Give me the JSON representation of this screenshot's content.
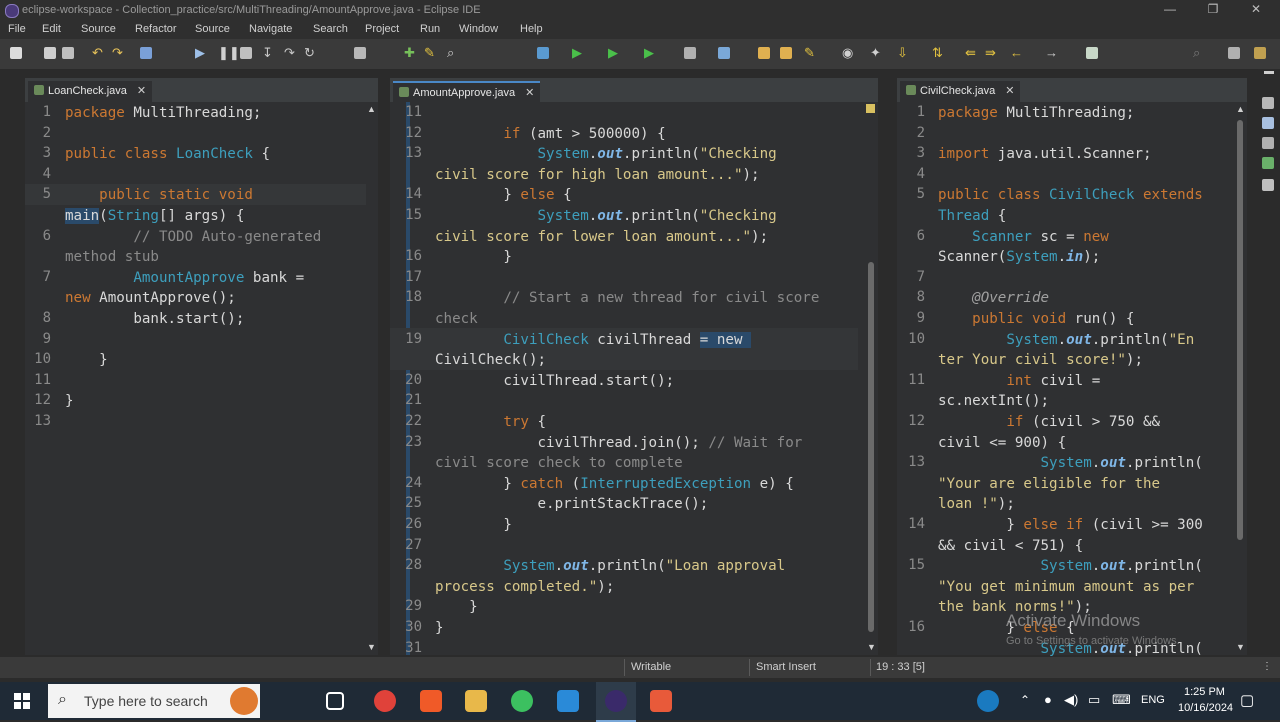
{
  "window": {
    "title": "eclipse-workspace - Collection_practice/src/MultiThreading/AmountApprove.java - Eclipse IDE",
    "controls": {
      "minimize": "—",
      "maximize": "❐",
      "close": "✕"
    }
  },
  "menu": {
    "items": [
      "File",
      "Edit",
      "Source",
      "Refactor",
      "Source",
      "Navigate",
      "Search",
      "Project",
      "Run",
      "Window",
      "Help"
    ]
  },
  "editors": {
    "left": {
      "tab": "LoanCheck.java",
      "lines": [
        {
          "n": "1",
          "segs": [
            [
              "k",
              "package "
            ],
            [
              "",
              "MultiThreading;"
            ]
          ]
        },
        {
          "n": "2",
          "segs": []
        },
        {
          "n": "3",
          "segs": [
            [
              "k",
              "public class "
            ],
            [
              "cls",
              "LoanCheck"
            ],
            [
              "",
              " {"
            ]
          ]
        },
        {
          "n": "4",
          "segs": []
        },
        {
          "n": "5",
          "segs": [
            [
              "k",
              "    public static void"
            ]
          ]
        },
        {
          "n": "",
          "segs": [
            [
              "hl",
              "main"
            ],
            [
              "",
              "("
            ],
            [
              "ty",
              "String"
            ],
            [
              "",
              "[] "
            ],
            [
              "",
              "args) {"
            ]
          ]
        },
        {
          "n": "6",
          "segs": [
            [
              "cm",
              "        // "
            ],
            [
              "cm",
              "TODO"
            ],
            [
              "cm",
              " Auto-generated"
            ]
          ]
        },
        {
          "n": "",
          "segs": [
            [
              "cm",
              "method stub"
            ]
          ]
        },
        {
          "n": "7",
          "segs": [
            [
              "ty",
              "        AmountApprove"
            ],
            [
              "",
              " bank ="
            ]
          ]
        },
        {
          "n": "",
          "segs": [
            [
              "k",
              "new "
            ],
            [
              "",
              "AmountApprove();"
            ]
          ]
        },
        {
          "n": "8",
          "segs": [
            [
              "",
              "        bank.start();"
            ]
          ]
        },
        {
          "n": "9",
          "segs": []
        },
        {
          "n": "10",
          "segs": [
            [
              "",
              "    }"
            ]
          ]
        },
        {
          "n": "11",
          "segs": []
        },
        {
          "n": "12",
          "segs": [
            [
              "",
              "}"
            ]
          ]
        },
        {
          "n": "13",
          "segs": []
        }
      ]
    },
    "middle": {
      "tab": "AmountApprove.java",
      "lines": [
        {
          "n": "11",
          "segs": []
        },
        {
          "n": "12",
          "segs": [
            [
              "k",
              "        if "
            ],
            [
              "",
              "(amt > 500000) {"
            ]
          ]
        },
        {
          "n": "13",
          "segs": [
            [
              "sys",
              "            System"
            ],
            [
              "",
              "."
            ],
            [
              "fi",
              "out"
            ],
            [
              "",
              ".println("
            ],
            [
              "st",
              "\"Checking"
            ]
          ]
        },
        {
          "n": "",
          "segs": [
            [
              "st",
              "civil score for high loan amount...\""
            ],
            [
              "",
              ");"
            ]
          ]
        },
        {
          "n": "14",
          "segs": [
            [
              "",
              "        } "
            ],
            [
              "k",
              "else"
            ],
            [
              "",
              " {"
            ]
          ]
        },
        {
          "n": "15",
          "segs": [
            [
              "sys",
              "            System"
            ],
            [
              "",
              "."
            ],
            [
              "fi",
              "out"
            ],
            [
              "",
              ".println("
            ],
            [
              "st",
              "\"Checking"
            ]
          ]
        },
        {
          "n": "",
          "segs": [
            [
              "st",
              "civil score for lower loan amount...\""
            ],
            [
              "",
              ");"
            ]
          ]
        },
        {
          "n": "16",
          "segs": [
            [
              "",
              "        }"
            ]
          ]
        },
        {
          "n": "17",
          "segs": []
        },
        {
          "n": "18",
          "segs": [
            [
              "cm",
              "        // Start a new thread for civil score"
            ]
          ]
        },
        {
          "n": "",
          "segs": [
            [
              "cm",
              "check"
            ]
          ]
        },
        {
          "n": "19",
          "segs": [
            [
              "ty",
              "        CivilCheck"
            ],
            [
              "",
              " civilThread "
            ],
            [
              "hl",
              "= new "
            ]
          ]
        },
        {
          "n": "",
          "segs": [
            [
              "",
              "CivilCheck();"
            ]
          ]
        },
        {
          "n": "20",
          "segs": [
            [
              "",
              "        civilThread.start();"
            ]
          ]
        },
        {
          "n": "21",
          "segs": []
        },
        {
          "n": "22",
          "segs": [
            [
              "k",
              "        try"
            ],
            [
              "",
              " {"
            ]
          ]
        },
        {
          "n": "23",
          "segs": [
            [
              "",
              "            civilThread.join(); "
            ],
            [
              "cm",
              "// Wait for"
            ]
          ]
        },
        {
          "n": "",
          "segs": [
            [
              "cm",
              "civil score check to complete"
            ]
          ]
        },
        {
          "n": "24",
          "segs": [
            [
              "",
              "        } "
            ],
            [
              "k",
              "catch"
            ],
            [
              "",
              " ("
            ],
            [
              "ty",
              "InterruptedException"
            ],
            [
              "",
              " e) {"
            ]
          ]
        },
        {
          "n": "25",
          "segs": [
            [
              "",
              "            e.printStackTrace();"
            ]
          ]
        },
        {
          "n": "26",
          "segs": [
            [
              "",
              "        }"
            ]
          ]
        },
        {
          "n": "27",
          "segs": []
        },
        {
          "n": "28",
          "segs": [
            [
              "sys",
              "        System"
            ],
            [
              "",
              "."
            ],
            [
              "fi",
              "out"
            ],
            [
              "",
              ".println("
            ],
            [
              "st",
              "\"Loan approval"
            ]
          ]
        },
        {
          "n": "",
          "segs": [
            [
              "st",
              "process completed.\""
            ],
            [
              "",
              ");"
            ]
          ]
        },
        {
          "n": "29",
          "segs": [
            [
              "",
              "    }"
            ]
          ]
        },
        {
          "n": "30",
          "segs": [
            [
              "",
              "}"
            ]
          ]
        },
        {
          "n": "31",
          "segs": []
        }
      ]
    },
    "right": {
      "tab": "CivilCheck.java",
      "lines": [
        {
          "n": "1",
          "segs": [
            [
              "k",
              "package "
            ],
            [
              "",
              "MultiThreading;"
            ]
          ]
        },
        {
          "n": "2",
          "segs": []
        },
        {
          "n": "3",
          "segs": [
            [
              "k",
              "import "
            ],
            [
              "",
              "java.util.Scanner;"
            ]
          ]
        },
        {
          "n": "4",
          "segs": []
        },
        {
          "n": "5",
          "segs": [
            [
              "k",
              "public class "
            ],
            [
              "cls",
              "CivilCheck"
            ],
            [
              "k",
              " extends"
            ]
          ]
        },
        {
          "n": "",
          "segs": [
            [
              "ty",
              "Thread"
            ],
            [
              "",
              " {"
            ]
          ]
        },
        {
          "n": "6",
          "segs": [
            [
              "ty",
              "    Scanner"
            ],
            [
              "",
              " sc = "
            ],
            [
              "k",
              "new"
            ]
          ]
        },
        {
          "n": "",
          "segs": [
            [
              "",
              "Scanner("
            ],
            [
              "sys",
              "System"
            ],
            [
              "",
              "."
            ],
            [
              "fi",
              "in"
            ],
            [
              "",
              ");"
            ]
          ]
        },
        {
          "n": "7",
          "segs": []
        },
        {
          "n": "8",
          "segs": [
            [
              "an",
              "    @Override"
            ]
          ]
        },
        {
          "n": "9",
          "segs": [
            [
              "k",
              "    public void "
            ],
            [
              "",
              "run() {"
            ]
          ]
        },
        {
          "n": "10",
          "segs": [
            [
              "sys",
              "        System"
            ],
            [
              "",
              "."
            ],
            [
              "fi",
              "out"
            ],
            [
              "",
              ".println("
            ],
            [
              "st",
              "\"En"
            ]
          ]
        },
        {
          "n": "",
          "segs": [
            [
              "st",
              "ter Your civil score!\""
            ],
            [
              "",
              ");"
            ]
          ]
        },
        {
          "n": "11",
          "segs": [
            [
              "k",
              "        int "
            ],
            [
              "",
              "civil ="
            ]
          ]
        },
        {
          "n": "",
          "segs": [
            [
              "",
              "sc.nextInt();"
            ]
          ]
        },
        {
          "n": "12",
          "segs": [
            [
              "k",
              "        if "
            ],
            [
              "",
              "(civil > 750 &&"
            ]
          ]
        },
        {
          "n": "",
          "segs": [
            [
              "",
              "civil <= 900) {"
            ]
          ]
        },
        {
          "n": "13",
          "segs": [
            [
              "sys",
              "            System"
            ],
            [
              "",
              "."
            ],
            [
              "fi",
              "out"
            ],
            [
              "",
              ".println("
            ]
          ]
        },
        {
          "n": "",
          "segs": [
            [
              "st",
              "\"Your are eligible for the"
            ]
          ]
        },
        {
          "n": "",
          "segs": [
            [
              "st",
              "loan !\""
            ],
            [
              "",
              ");"
            ]
          ]
        },
        {
          "n": "14",
          "segs": [
            [
              "",
              "        } "
            ],
            [
              "k",
              "else if "
            ],
            [
              "",
              "(civil >= 300"
            ]
          ]
        },
        {
          "n": "",
          "segs": [
            [
              "",
              "&& civil < 751) {"
            ]
          ]
        },
        {
          "n": "15",
          "segs": [
            [
              "sys",
              "            System"
            ],
            [
              "",
              "."
            ],
            [
              "fi",
              "out"
            ],
            [
              "",
              ".println("
            ]
          ]
        },
        {
          "n": "",
          "segs": [
            [
              "st",
              "\"You get minimum amount as per"
            ]
          ]
        },
        {
          "n": "",
          "segs": [
            [
              "st",
              "the bank norms!\""
            ],
            [
              "",
              ");"
            ]
          ]
        },
        {
          "n": "16",
          "segs": [
            [
              "",
              "        } "
            ],
            [
              "k",
              "else"
            ],
            [
              "",
              " {"
            ]
          ]
        },
        {
          "n": "",
          "segs": [
            [
              "sys",
              "            System"
            ],
            [
              "",
              "."
            ],
            [
              "fi",
              "out"
            ],
            [
              "",
              ".println("
            ]
          ]
        }
      ]
    }
  },
  "status": {
    "writable": "Writable",
    "insert_mode": "Smart Insert",
    "position": "19 : 33 [5]"
  },
  "watermark": {
    "line1": "Activate Windows",
    "line2": "Go to Settings to activate Windows."
  },
  "taskbar": {
    "search_placeholder": "Type here to search",
    "language": "ENG",
    "time": "1:25 PM",
    "date": "10/16/2024"
  }
}
